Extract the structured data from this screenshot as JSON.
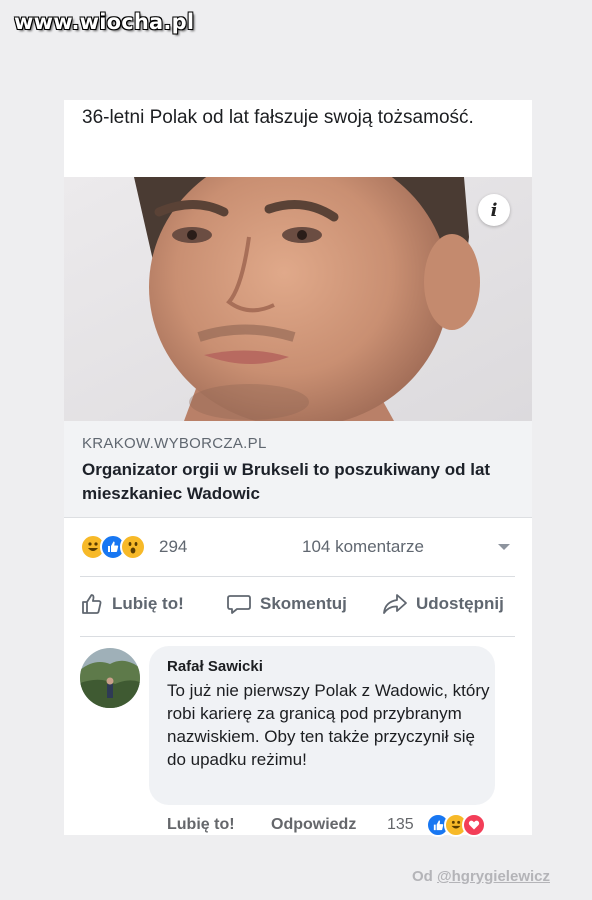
{
  "watermark": "www.wiocha.pl",
  "post": {
    "text": "36-letni Polak od lat fałszuje swoją tożsamość."
  },
  "link": {
    "domain": "KRAKOW.WYBORCZA.PL",
    "title": "Organizator orgii w Brukseli to poszukiwany od lat mieszkaniec Wadowic",
    "info_icon": "i"
  },
  "stats": {
    "reaction_icons": [
      "haha-icon",
      "like-icon",
      "wow-icon"
    ],
    "reactions_count": "294",
    "comments_count": "104 komentarze"
  },
  "actions": {
    "like": "Lubię to!",
    "comment": "Skomentuj",
    "share": "Udostępnij"
  },
  "comment": {
    "author": "Rafał Sawicki",
    "text": "To już nie pierwszy Polak z Wadowic, który robi karierę za granicą pod przybranym nazwiskiem. Oby ten także przyczynił się do upadku reżimu!",
    "like": "Lubię to!",
    "reply": "Odpowiedz",
    "reactions_count": "135",
    "reaction_icons": [
      "like-icon",
      "haha-icon",
      "love-icon"
    ]
  },
  "credit": {
    "prefix": "Od ",
    "handle": "@hgrygielewicz"
  },
  "colors": {
    "like_blue": "#1877f2",
    "haha_yellow": "#f7b928",
    "love_red": "#f33e58",
    "secondary_text": "#606770"
  }
}
